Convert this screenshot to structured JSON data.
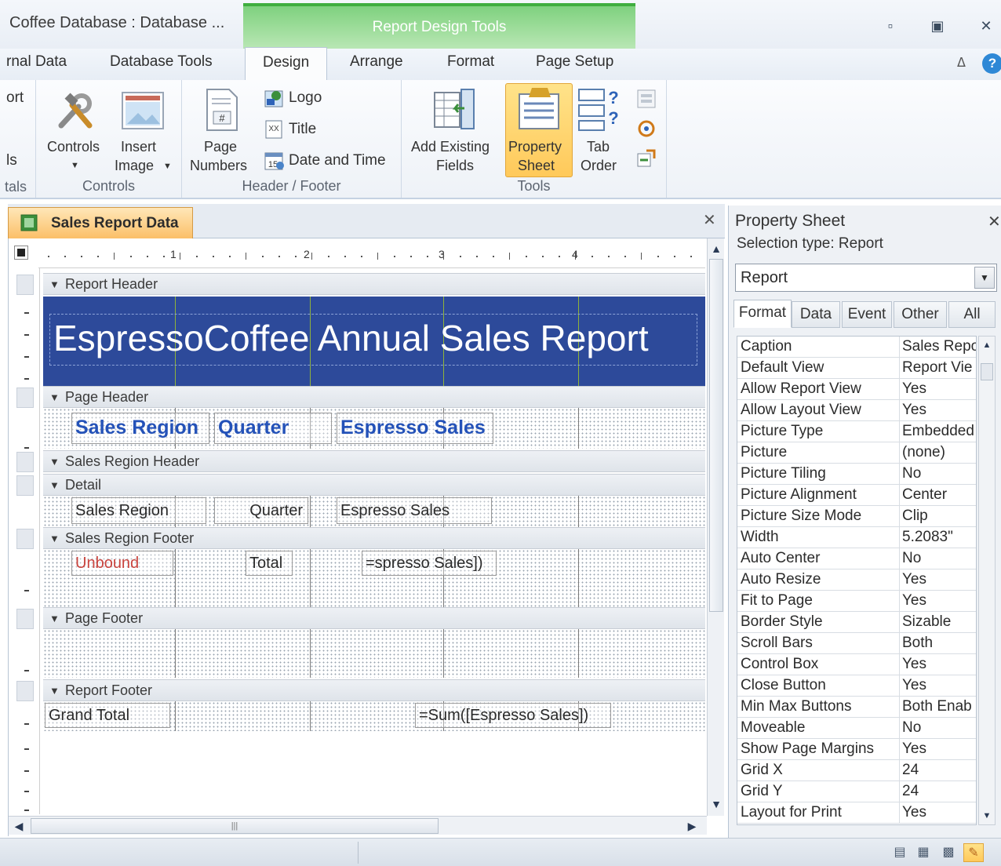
{
  "window": {
    "title": "Coffee Database : Database ...",
    "context_group": "Report Design Tools",
    "minimize_icon": "minimize-icon",
    "restore_icon": "restore-icon",
    "close_icon": "close-icon"
  },
  "tabs": {
    "external_data": "rnal Data",
    "database_tools": "Database Tools",
    "design": "Design",
    "arrange": "Arrange",
    "format": "Format",
    "page_setup": "Page Setup",
    "help": "?"
  },
  "ribbon": {
    "partial_left": {
      "top": "ort",
      "mid": "ls",
      "bottom": "tals"
    },
    "controls_group": {
      "controls_label": "Controls",
      "insert_image_line1": "Insert",
      "insert_image_line2": "Image",
      "group_label": "Controls"
    },
    "header_footer_group": {
      "page_numbers_line1": "Page",
      "page_numbers_line2": "Numbers",
      "logo": "Logo",
      "title": "Title",
      "date_time": "Date and Time",
      "group_label": "Header / Footer"
    },
    "tools_group": {
      "add_fields_line1": "Add Existing",
      "add_fields_line2": "Fields",
      "property_sheet_line1": "Property",
      "property_sheet_line2": "Sheet",
      "tab_order_line1": "Tab",
      "tab_order_line2": "Order",
      "group_label": "Tools"
    }
  },
  "document": {
    "tab_title": "Sales Report Data",
    "ruler_numbers": [
      "1",
      "2",
      "3",
      "4"
    ],
    "sections": {
      "report_header": "Report Header",
      "page_header": "Page Header",
      "sales_region_header": "Sales Region Header",
      "detail": "Detail",
      "sales_region_footer": "Sales Region Footer",
      "page_footer": "Page Footer",
      "report_footer": "Report Footer"
    },
    "report_title": "EspressoCoffee Annual Sales Report",
    "page_header_labels": [
      "Sales Region",
      "Quarter",
      "Espresso Sales"
    ],
    "detail_fields": [
      "Sales Region",
      "Quarter",
      "Espresso Sales"
    ],
    "footer_controls": {
      "unbound": "Unbound",
      "total": "Total",
      "sum_expr": "=spresso Sales])"
    },
    "report_footer_controls": {
      "grand_total": "Grand Total",
      "sum_expr": "=Sum([Espresso Sales])"
    }
  },
  "property_sheet": {
    "title": "Property Sheet",
    "selection_type": "Selection type:  Report",
    "selected_object": "Report",
    "tabs": [
      "Format",
      "Data",
      "Event",
      "Other",
      "All"
    ],
    "active_tab": "Format",
    "properties": [
      {
        "name": "Caption",
        "value": "Sales Repo"
      },
      {
        "name": "Default View",
        "value": "Report Vie"
      },
      {
        "name": "Allow Report View",
        "value": "Yes"
      },
      {
        "name": "Allow Layout View",
        "value": "Yes"
      },
      {
        "name": "Picture Type",
        "value": "Embedded"
      },
      {
        "name": "Picture",
        "value": "(none)"
      },
      {
        "name": "Picture Tiling",
        "value": "No"
      },
      {
        "name": "Picture Alignment",
        "value": "Center"
      },
      {
        "name": "Picture Size Mode",
        "value": "Clip"
      },
      {
        "name": "Width",
        "value": "5.2083\""
      },
      {
        "name": "Auto Center",
        "value": "No"
      },
      {
        "name": "Auto Resize",
        "value": "Yes"
      },
      {
        "name": "Fit to Page",
        "value": "Yes"
      },
      {
        "name": "Border Style",
        "value": "Sizable"
      },
      {
        "name": "Scroll Bars",
        "value": "Both"
      },
      {
        "name": "Control Box",
        "value": "Yes"
      },
      {
        "name": "Close Button",
        "value": "Yes"
      },
      {
        "name": "Min Max Buttons",
        "value": "Both Enab"
      },
      {
        "name": "Moveable",
        "value": "No"
      },
      {
        "name": "Show Page Margins",
        "value": "Yes"
      },
      {
        "name": "Grid X",
        "value": "24"
      },
      {
        "name": "Grid Y",
        "value": "24"
      },
      {
        "name": "Layout for Print",
        "value": "Yes"
      }
    ]
  },
  "status_bar": {
    "views": [
      "report-view-icon",
      "print-preview-icon",
      "layout-view-icon",
      "design-view-icon"
    ],
    "active_view": "design-view-icon"
  },
  "colors": {
    "report_header_band": "#2d4a9a",
    "context_tab_green": "#7fd17f",
    "document_tab": "#fbbf68",
    "label_blue": "#2452b8",
    "unbound_red": "#c9443e"
  }
}
